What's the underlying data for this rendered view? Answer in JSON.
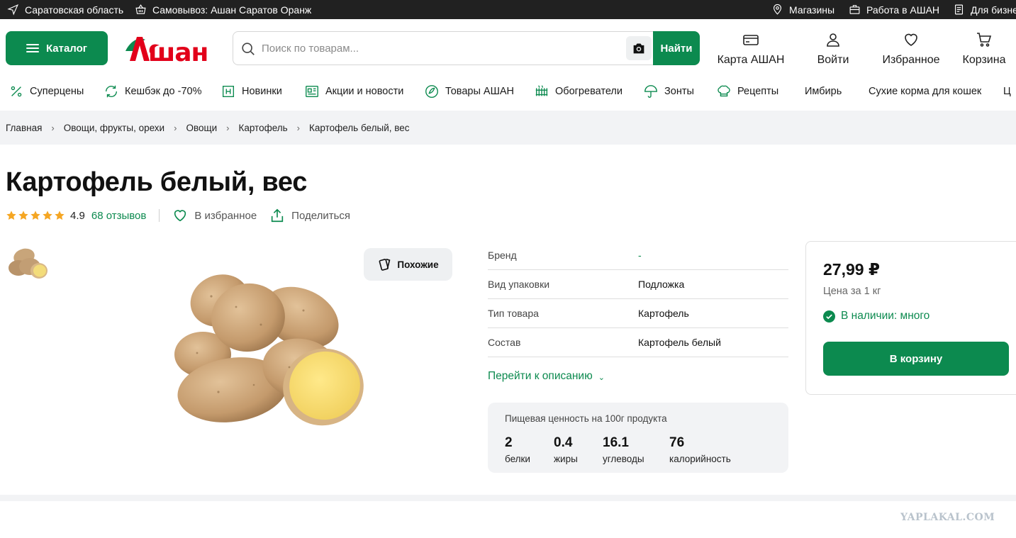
{
  "topbar": {
    "region": "Саратовская область",
    "pickup": "Самовывоз: Ашан Саратов Оранж",
    "stores": "Магазины",
    "jobs": "Работа в АШАН",
    "business": "Для бизне"
  },
  "header": {
    "catalog_label": "Каталог",
    "logo_text": "Ашан",
    "search_placeholder": "Поиск по товарам...",
    "find_label": "Найти",
    "card_label": "Карта АШАН",
    "login_label": "Войти",
    "favorites_label": "Избранное",
    "cart_label": "Корзина"
  },
  "nav": {
    "items": [
      {
        "label": "Суперцены",
        "icon": "percent-icon"
      },
      {
        "label": "Кешбэк до -70%",
        "icon": "cashback-icon"
      },
      {
        "label": "Новинки",
        "icon": "new-icon"
      },
      {
        "label": "Акции и новости",
        "icon": "news-icon"
      },
      {
        "label": "Товары АШАН",
        "icon": "auchan-goods-icon"
      },
      {
        "label": "Обогреватели",
        "icon": "heater-icon"
      },
      {
        "label": "Зонты",
        "icon": "umbrella-icon"
      },
      {
        "label": "Рецепты",
        "icon": "chef-hat-icon"
      },
      {
        "label": "Имбирь"
      },
      {
        "label": "Сухие корма для кошек"
      },
      {
        "label": "Ц"
      }
    ]
  },
  "breadcrumbs": [
    "Главная",
    "Овощи, фрукты, орехи",
    "Овощи",
    "Картофель",
    "Картофель белый, вес"
  ],
  "product": {
    "title": "Картофель белый, вес",
    "rating": "4.9",
    "stars_of_5": 5,
    "reviews": "68 отзывов",
    "favorite_label": "В избранное",
    "share_label": "Поделиться",
    "similar_label": "Похожие"
  },
  "specs": [
    {
      "key": "Бренд",
      "value": "-",
      "accent": true
    },
    {
      "key": "Вид упаковки",
      "value": "Подложка"
    },
    {
      "key": "Тип товара",
      "value": "Картофель"
    },
    {
      "key": "Состав",
      "value": "Картофель белый"
    }
  ],
  "desc_link": "Перейти к описанию",
  "nutrition": {
    "heading": "Пищевая ценность на 100г продукта",
    "items": [
      {
        "value": "2",
        "label": "белки"
      },
      {
        "value": "0.4",
        "label": "жиры"
      },
      {
        "value": "16.1",
        "label": "углеводы"
      },
      {
        "value": "76",
        "label": "калорийность"
      }
    ]
  },
  "buy": {
    "price": "27,99 ₽",
    "unit": "Цена за 1 кг",
    "stock": "В наличии: много",
    "cart_button": "В корзину"
  },
  "watermark": "YAPLAKAL.COM",
  "colors": {
    "brand_green": "#0c8a4f",
    "brand_red": "#e2001a",
    "star": "#f5a623"
  }
}
